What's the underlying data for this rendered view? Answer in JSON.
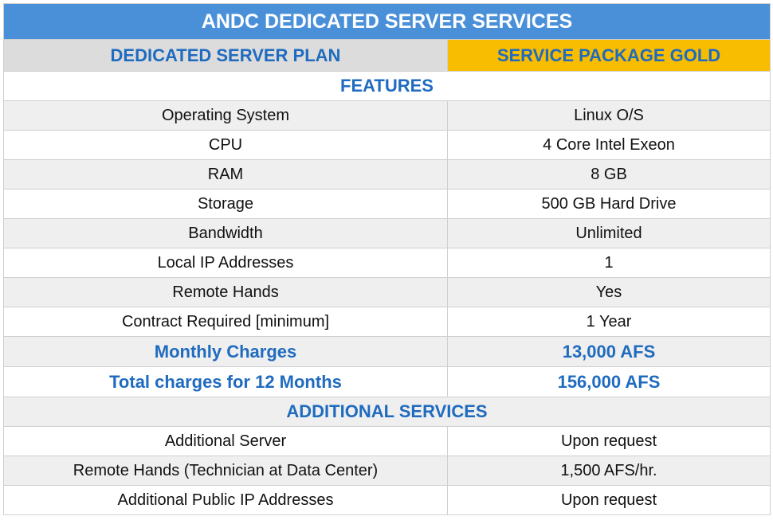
{
  "title": "ANDC DEDICATED SERVER SERVICES",
  "plan_header": {
    "label": "DEDICATED SERVER PLAN",
    "package": "SERVICE PACKAGE GOLD"
  },
  "features_heading": "FEATURES",
  "features": [
    {
      "name": "Operating System",
      "value": "Linux O/S"
    },
    {
      "name": "CPU",
      "value": "4 Core Intel Exeon"
    },
    {
      "name": "RAM",
      "value": "8 GB"
    },
    {
      "name": "Storage",
      "value": "500 GB Hard Drive"
    },
    {
      "name": "Bandwidth",
      "value": "Unlimited"
    },
    {
      "name": "Local IP Addresses",
      "value": "1"
    },
    {
      "name": "Remote Hands",
      "value": "Yes"
    },
    {
      "name": "Contract Required [minimum]",
      "value": "1 Year"
    }
  ],
  "charges": [
    {
      "name": "Monthly Charges",
      "value": "13,000 AFS"
    },
    {
      "name": "Total charges for 12 Months",
      "value": "156,000 AFS"
    }
  ],
  "additional_heading": "ADDITIONAL SERVICES",
  "additional_services": [
    {
      "name": "Additional Server",
      "value": "Upon request"
    },
    {
      "name": "Remote Hands (Technician at Data Center)",
      "value": "1,500 AFS/hr."
    },
    {
      "name": "Additional Public IP Addresses",
      "value": "Upon request"
    }
  ],
  "colors": {
    "title_bg": "#4a90d9",
    "accent_text": "#1f6bbf",
    "gold": "#f8bc00",
    "header_gray": "#dcdcdc",
    "row_shade": "#efefef"
  }
}
